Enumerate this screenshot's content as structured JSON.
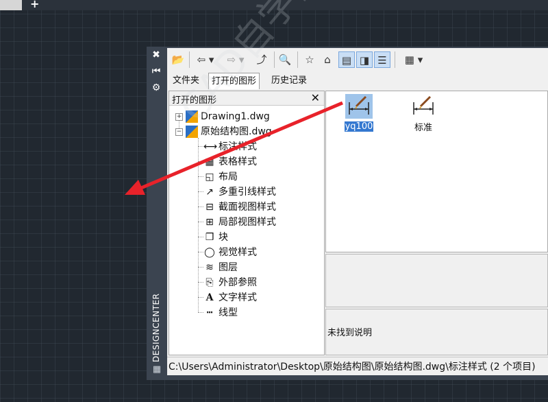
{
  "app_tabs": {
    "plus": "+"
  },
  "design_center": {
    "vertical_title": "DESIGNCENTER",
    "tabs": [
      "文件夹",
      "打开的图形",
      "历史记录"
    ],
    "active_tab": "打开的图形",
    "tree": {
      "header": "打开的图形",
      "close": "✕",
      "drawings": [
        {
          "label": "Drawing1.dwg",
          "expander": "+"
        },
        {
          "label": "原始结构图.dwg",
          "expander": "−"
        }
      ],
      "children": [
        "标注样式",
        "表格样式",
        "布局",
        "多重引线样式",
        "截面视图样式",
        "局部视图样式",
        "块",
        "视觉样式",
        "图层",
        "外部参照",
        "文字样式",
        "线型"
      ]
    },
    "palette_items": [
      {
        "label": "yq100",
        "selected": true
      },
      {
        "label": "标准",
        "selected": false
      }
    ],
    "description": "未找到说明",
    "status_path": "C:\\Users\\Administrator\\Desktop\\原始结构图\\原始结构图.dwg\\标注样式 (2 个项目)"
  },
  "watermark": "CAD自学网 www.cadzxw.com",
  "colors": {
    "accent": "#3478d0",
    "arrow": "#e8222a"
  }
}
